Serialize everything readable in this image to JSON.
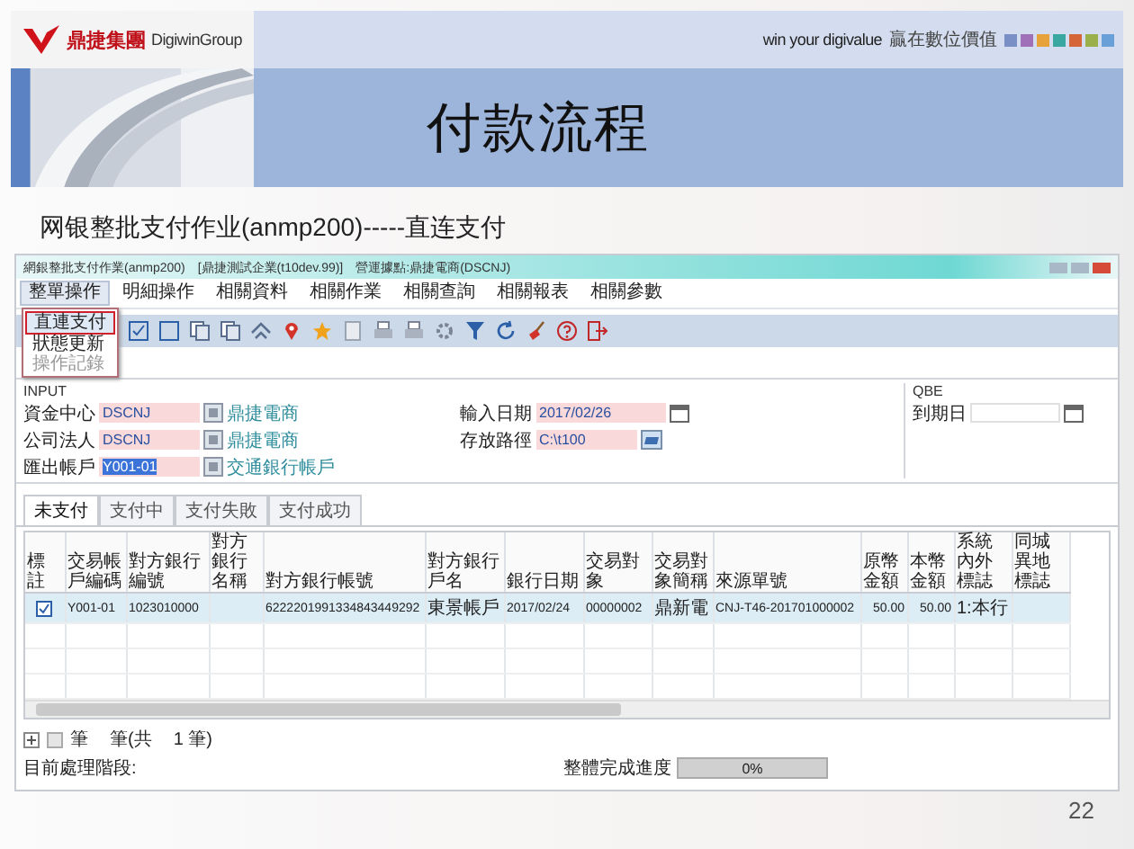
{
  "slide": {
    "logo_text": "鼎捷集團",
    "logo_brand": "DigiwinGroup",
    "tagline": "win your digivalue",
    "tagline_cn": "贏在數位價值",
    "title": "付款流程",
    "subtitle": "网银整批支付作业(anmp200)-----直连支付",
    "page_number": "22"
  },
  "app": {
    "window_title": "網銀整批支付作業(anmp200)　[鼎捷測試企業(t10dev.99)]　營運據點:鼎捷電商(DSCNJ)",
    "menu": [
      {
        "label": "整單操作",
        "open": true
      },
      {
        "label": "明細操作",
        "open": false
      },
      {
        "label": "相關資料",
        "open": false
      },
      {
        "label": "相關作業",
        "open": false
      },
      {
        "label": "相關查詢",
        "open": false
      },
      {
        "label": "相關報表",
        "open": false
      },
      {
        "label": "相關參數",
        "open": false
      }
    ],
    "dropdown": [
      {
        "label": "直連支付",
        "selected": true,
        "disabled": false
      },
      {
        "label": "狀態更新",
        "selected": false,
        "disabled": false
      },
      {
        "label": "操作記錄",
        "selected": false,
        "disabled": true
      }
    ],
    "input_group": {
      "title": "INPUT",
      "fields": [
        {
          "label": "資金中心",
          "value": "DSCNJ",
          "kind": "lookup",
          "description": "鼎捷電商",
          "selected": false
        },
        {
          "label": "輸入日期",
          "value": "2017/02/26",
          "kind": "date",
          "selected": false
        },
        {
          "label": "公司法人",
          "value": "DSCNJ",
          "kind": "lookup",
          "description": "鼎捷電商",
          "selected": false
        },
        {
          "label": "存放路徑",
          "value": "C:\\t100",
          "kind": "path",
          "selected": false
        },
        {
          "label": "匯出帳戶",
          "value": "Y001-01",
          "kind": "lookup",
          "description": "交通銀行帳戶",
          "selected": true
        }
      ]
    },
    "qbe_group": {
      "title": "QBE",
      "fields": [
        {
          "label": "到期日",
          "kind": "date"
        }
      ]
    },
    "tabs": [
      {
        "label": "未支付",
        "selected": true
      },
      {
        "label": "支付中",
        "selected": false
      },
      {
        "label": "支付失敗",
        "selected": false
      },
      {
        "label": "支付成功",
        "selected": false
      }
    ],
    "table": {
      "columns": [
        "標註",
        "交易帳戶編碼",
        "對方銀行編號",
        "對方銀行名稱",
        "對方銀行帳號",
        "對方銀行戶名",
        "銀行日期",
        "交易對象",
        "交易對象簡稱",
        "來源單號",
        "原幣金額",
        "本幣金額",
        "系統內外標誌",
        "同城異地標誌"
      ],
      "rows": [
        {
          "checked": true,
          "selected": true,
          "cells": [
            "",
            "Y001-01",
            "1023010000",
            "",
            "6222201991334843449292",
            "東景帳戶",
            "2017/02/24",
            "00000002",
            "鼎新電",
            "CNJ-T46-201701000002",
            "50.00",
            "50.00",
            "1:本行",
            ""
          ]
        }
      ]
    },
    "record_count": [
      "筆",
      "筆(共",
      "1 筆)"
    ],
    "stage_label": "目前處理階段:",
    "progress": {
      "label": "整體完成進度",
      "level": 0,
      "reading": "0%"
    }
  }
}
